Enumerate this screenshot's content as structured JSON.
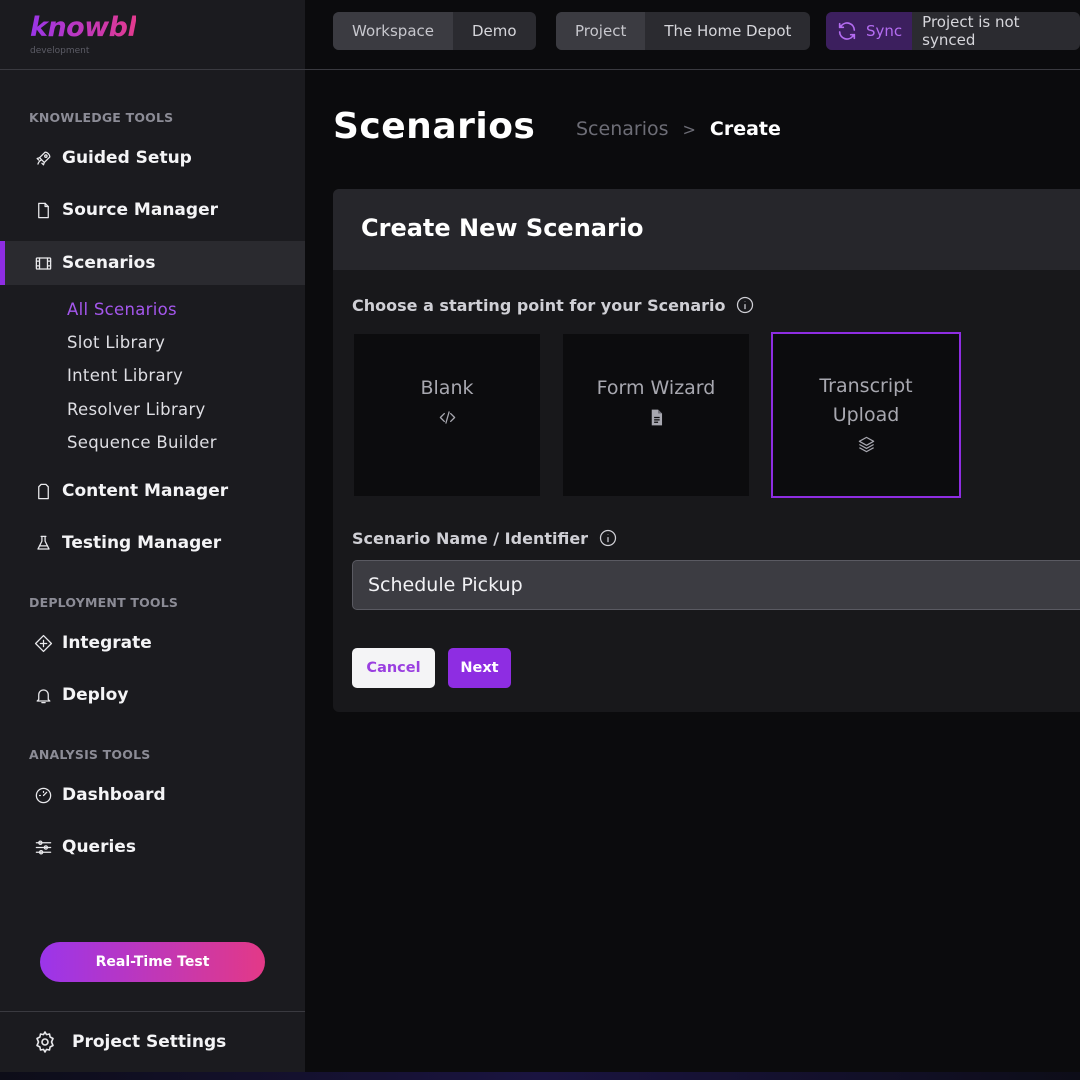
{
  "brand": {
    "logo": "knowbl",
    "environment": "development"
  },
  "topbar": {
    "workspace_key": "Workspace",
    "workspace_value": "Demo",
    "project_key": "Project",
    "project_value": "The Home Depot",
    "sync_label": "Sync",
    "sync_status": "Project is not synced"
  },
  "sidebar": {
    "knowledge_label": "KNOWLEDGE TOOLS",
    "guided_setup": "Guided Setup",
    "source_manager": "Source Manager",
    "scenarios": "Scenarios",
    "sub_items": [
      "All Scenarios",
      "Slot Library",
      "Intent Library",
      "Resolver Library",
      "Sequence Builder"
    ],
    "content_manager": "Content Manager",
    "testing_manager": "Testing Manager",
    "deployment_label": "DEPLOYMENT TOOLS",
    "integrate": "Integrate",
    "deploy": "Deploy",
    "analysis_label": "ANALYSIS TOOLS",
    "dashboard": "Dashboard",
    "queries": "Queries",
    "real_time_test": "Real-Time Test",
    "project_settings": "Project Settings"
  },
  "header": {
    "title": "Scenarios",
    "breadcrumb_prev": "Scenarios",
    "breadcrumb_sep": ">",
    "breadcrumb_current": "Create"
  },
  "form": {
    "title": "Create New Scenario",
    "starting_point_label": "Choose a starting point for your Scenario",
    "tiles": [
      {
        "label": "Blank",
        "icon": "code-icon"
      },
      {
        "label": "Form Wizard",
        "icon": "document-icon"
      },
      {
        "label_line1": "Transcript",
        "label_line2": "Upload",
        "icon": "layers-icon",
        "selected": true
      }
    ],
    "name_label": "Scenario Name / Identifier",
    "name_value": "Schedule Pickup",
    "cancel_label": "Cancel",
    "next_label": "Next"
  },
  "colors": {
    "accent": "#8e2de2",
    "sidebar_bg": "#1b1b1f",
    "main_bg": "#0b0b0d",
    "gradient_start": "#9b35ea",
    "gradient_end": "#e33987"
  }
}
